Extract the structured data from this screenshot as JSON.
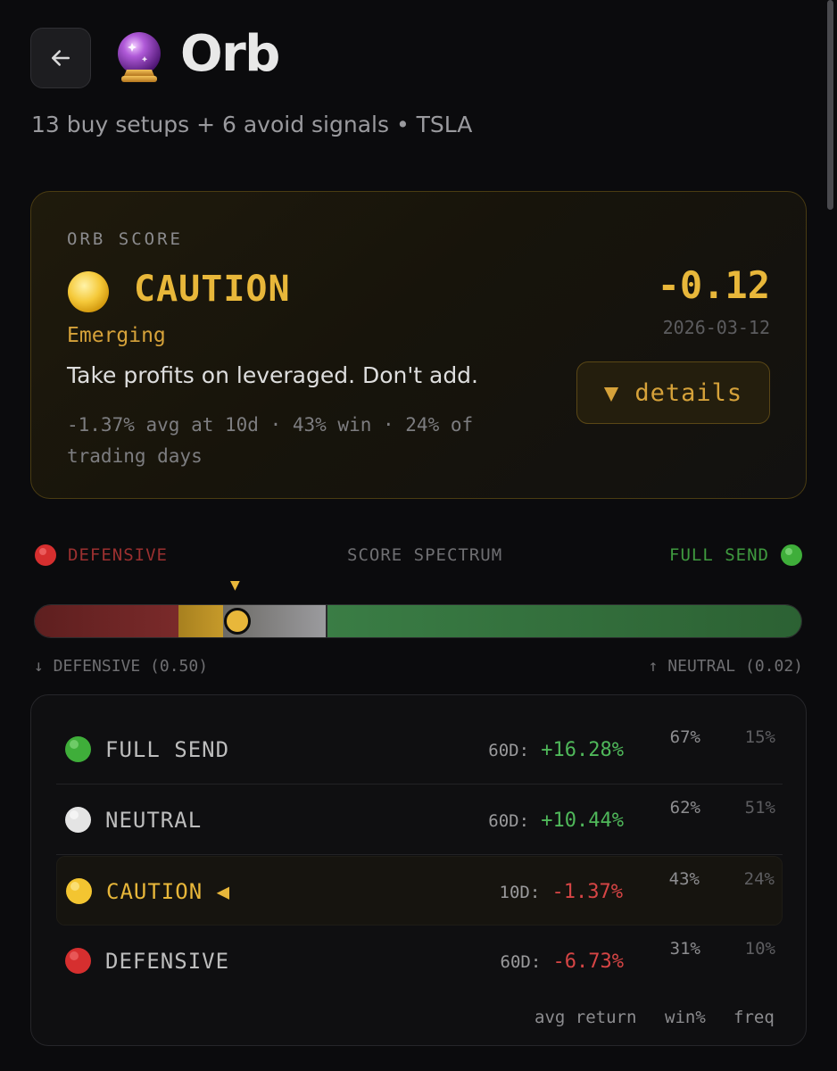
{
  "header": {
    "title": "Orb",
    "subtitle": "13 buy setups + 6 avoid signals • TSLA",
    "back_icon": "arrow-left-icon",
    "logo_icon": "crystal-ball-icon"
  },
  "score_card": {
    "label": "ORB SCORE",
    "status": "CAUTION",
    "status_dot_color": "#f3c531",
    "stage": "Emerging",
    "advice": "Take profits on leveraged. Don't add.",
    "stats": "-1.37% avg at 10d · 43% win · 24% of trading days",
    "score": "-0.12",
    "date": "2026-03-12",
    "details_label": "▼ details"
  },
  "spectrum": {
    "left_label": "DEFENSIVE",
    "center_label": "SCORE SPECTRUM",
    "right_label": "FULL SEND",
    "marker": "▼",
    "below_left": "↓ DEFENSIVE (0.50)",
    "below_right": "↑ NEUTRAL (0.02)",
    "colors": {
      "defensive": "#7a2a2a",
      "caution": "#c69a2a",
      "neutral": "#9b9b9e",
      "full_send": "#3a7d45"
    }
  },
  "tiers": [
    {
      "name": "FULL SEND",
      "dot_color": "#3fae3a",
      "return_label": "60D:",
      "return_value": "+16.28%",
      "sign": "pos",
      "win": "67%",
      "freq": "15%"
    },
    {
      "name": "NEUTRAL",
      "dot_color": "#e6e6e6",
      "return_label": "60D:",
      "return_value": "+10.44%",
      "sign": "pos",
      "win": "62%",
      "freq": "51%"
    },
    {
      "name": "CAUTION ◀",
      "dot_color": "#f3c531",
      "return_label": "10D:",
      "return_value": "-1.37%",
      "sign": "neg",
      "win": "43%",
      "freq": "24%",
      "active": true
    },
    {
      "name": "DEFENSIVE",
      "dot_color": "#d62f2f",
      "return_label": "60D:",
      "return_value": "-6.73%",
      "sign": "neg",
      "win": "31%",
      "freq": "10%"
    }
  ],
  "columns": {
    "avg_return": "avg return",
    "win": "win%",
    "freq": "freq"
  }
}
